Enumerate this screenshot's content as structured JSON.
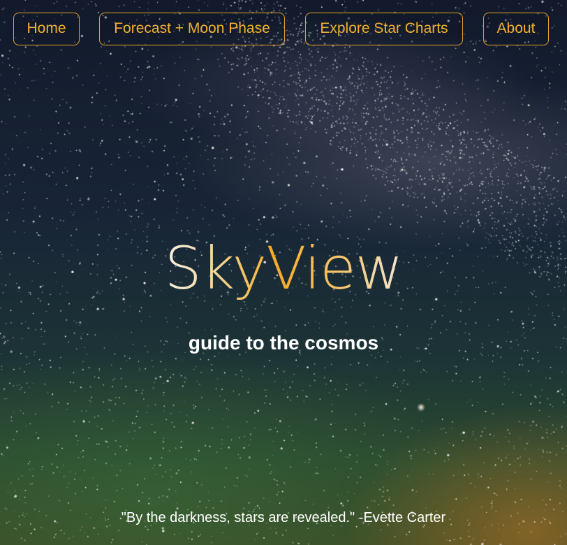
{
  "nav": {
    "items": [
      {
        "label": "Home"
      },
      {
        "label": "Forecast + Moon Phase"
      },
      {
        "label": "Explore Star Charts"
      },
      {
        "label": "About"
      }
    ]
  },
  "hero": {
    "title_part1": "Sky",
    "title_part2": "View",
    "subtitle": "guide to the cosmos"
  },
  "quote": {
    "text": "\"By the darkness, stars are revealed.\" -Evette Carter"
  },
  "colors": {
    "accent": "#f2b02e",
    "text": "#ffffff"
  }
}
